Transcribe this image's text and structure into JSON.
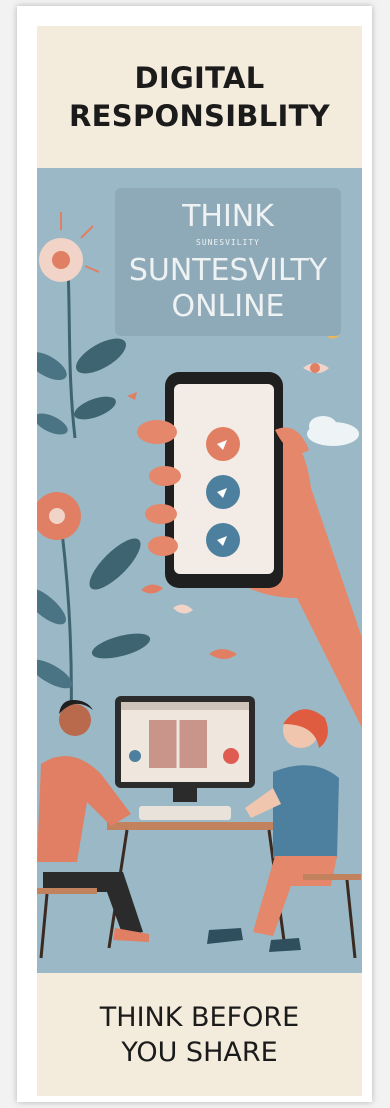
{
  "poster": {
    "title_lines": [
      "DIGITAL",
      "RESPONSIBLITY"
    ],
    "sign": {
      "line1": "THINK",
      "small_text": "SUNESVILITY",
      "line2": "SUNTESVILTY",
      "line3": "ONLINE"
    },
    "footer_lines": [
      "THINK BEFORE",
      "YOU SHARE"
    ]
  },
  "colors": {
    "background_blue": "#9ab8c5",
    "cream": "#f3ebdb",
    "coral": "#e07f63",
    "phone_icon_blue": "#4d7f9e",
    "dark_teal": "#3e6472"
  },
  "icons": [
    "flower-icon",
    "leaf-icon",
    "bird-icon",
    "cloud-icon",
    "smartphone-icon",
    "monitor-icon",
    "keyboard-icon"
  ]
}
